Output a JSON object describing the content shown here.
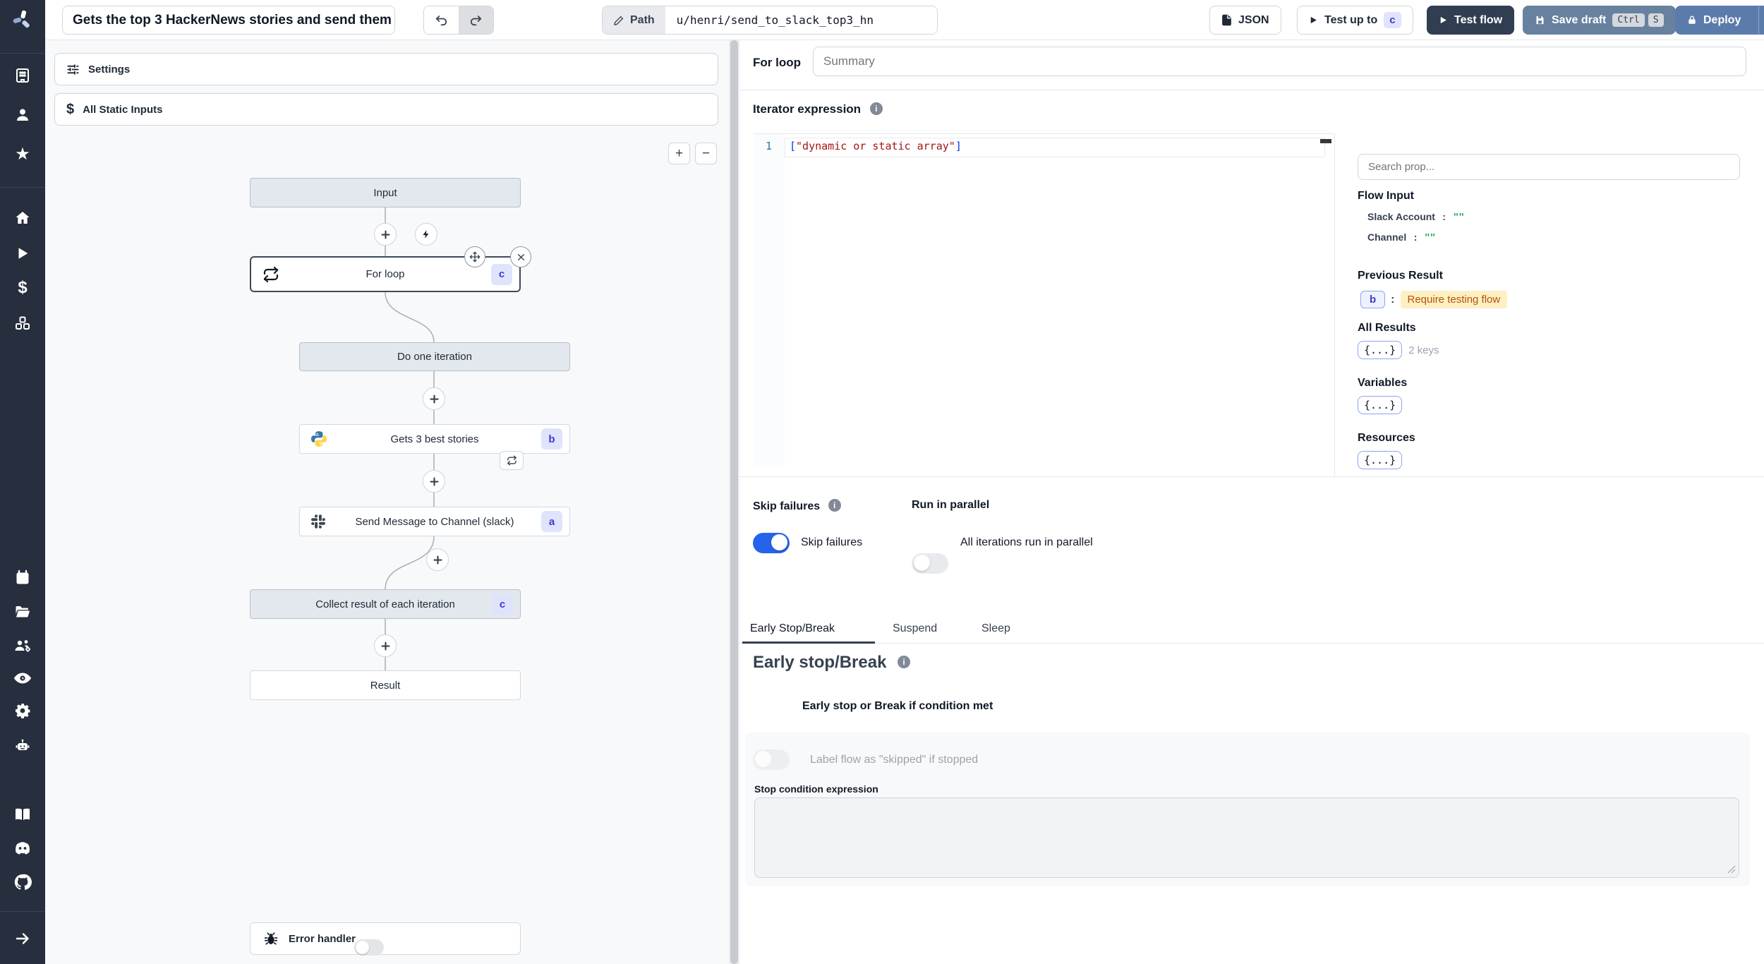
{
  "topbar": {
    "flow_title": "Gets the top 3 HackerNews stories and send them",
    "path_label": "Path",
    "path_value": "u/henri/send_to_slack_top3_hn",
    "json_button": "JSON",
    "test_up_to": "Test up to",
    "test_up_to_badge": "c",
    "test_flow": "Test flow",
    "save_draft": "Save draft",
    "kbd_ctrl": "Ctrl",
    "kbd_s": "S",
    "deploy": "Deploy"
  },
  "flow": {
    "settings_label": "Settings",
    "static_inputs_label": "All Static Inputs",
    "zoom_in": "+",
    "zoom_out": "−",
    "nodes": {
      "input": "Input",
      "for_loop": {
        "label": "For loop",
        "badge": "c"
      },
      "do_one_iteration": "Do one iteration",
      "gets_stories": {
        "label": "Gets 3 best stories",
        "badge": "b"
      },
      "send_message": {
        "label": "Send Message to Channel (slack)",
        "badge": "a"
      },
      "collect": {
        "label": "Collect result of each iteration",
        "badge": "c"
      },
      "result": "Result"
    },
    "error_handler_label": "Error handler"
  },
  "panel": {
    "node_label": "For loop",
    "summary_placeholder": "Summary",
    "iterator_label": "Iterator expression",
    "editor": {
      "line_number": "1",
      "bracket_open": "[",
      "string": "\"dynamic or static array\"",
      "bracket_close": "]"
    },
    "prop_picker": {
      "search_placeholder": "Search prop...",
      "flow_input_heading": "Flow Input",
      "props": [
        {
          "key": "Slack Account",
          "sep": ":",
          "value": "\"\""
        },
        {
          "key": "Channel",
          "sep": ":",
          "value": "\"\""
        }
      ],
      "previous_result_heading": "Previous Result",
      "previous_badge": "b",
      "previous_sep": ":",
      "previous_note": "Require testing flow",
      "all_results_heading": "All Results",
      "object_badge": "{...}",
      "keys_count": "2 keys",
      "variables_heading": "Variables",
      "resources_heading": "Resources"
    },
    "skip_failures_heading": "Skip failures",
    "skip_failures_label": "Skip failures",
    "run_in_parallel_heading": "Run in parallel",
    "run_in_parallel_label": "All iterations run in parallel",
    "tabs": {
      "early": "Early Stop/Break",
      "suspend": "Suspend",
      "sleep": "Sleep"
    },
    "early_stop": {
      "heading": "Early stop/Break",
      "condition_label": "Early stop or Break if condition met",
      "skipped_label": "Label flow as \"skipped\" if stopped",
      "stop_condition_label": "Stop condition expression"
    }
  },
  "colors": {
    "accent_toggle": "#2563eb",
    "badge_bg": "#dfe4fc",
    "badge_text": "#4338ca",
    "warning_bg": "#fdf0c2",
    "warning_text": "#b45309",
    "value_green": "#16a34a"
  }
}
